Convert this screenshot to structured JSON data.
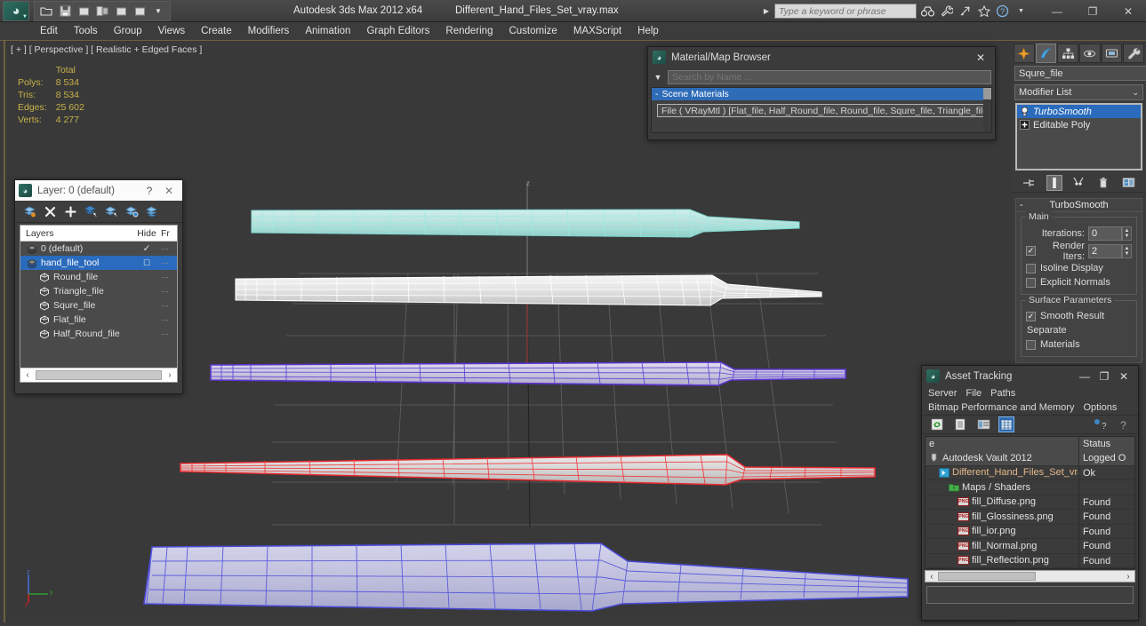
{
  "window": {
    "app_title": "Autodesk 3ds Max  2012 x64",
    "file_title": "Different_Hand_Files_Set_vray.max",
    "minimize": "—",
    "maximize": "❐",
    "close": "✕"
  },
  "quick_access": {
    "icons": [
      "open-file-icon",
      "save-file-icon",
      "undo-icon",
      "redo-icon",
      "blank-icon",
      "blank2-icon",
      "dropdown-arrow-icon"
    ]
  },
  "infocenter": {
    "placeholder": "Type a keyword or phrase",
    "value": "",
    "icons": [
      "binoculars-icon",
      "wrench-icon",
      "subscription-icon",
      "favorites-star-icon",
      "help-icon",
      "help-dropdown-icon"
    ]
  },
  "menu": {
    "items": [
      "Edit",
      "Tools",
      "Group",
      "Views",
      "Create",
      "Modifiers",
      "Animation",
      "Graph Editors",
      "Rendering",
      "Customize",
      "MAXScript",
      "Help"
    ]
  },
  "viewport": {
    "label": "[ + ] [ Perspective ] [ Realistic + Edged Faces ]",
    "stats": {
      "header": "Total",
      "rows": [
        {
          "label": "Polys:",
          "value": "8 534"
        },
        {
          "label": "Tris:",
          "value": "8 534"
        },
        {
          "label": "Edges:",
          "value": "25 602"
        },
        {
          "label": "Verts:",
          "value": "4 277"
        }
      ]
    },
    "axis_labels": {
      "z": "z",
      "y": "y",
      "x": "x"
    },
    "world_axis_labels": {
      "z": "z",
      "y": "y",
      "x": "x"
    },
    "object_colors": {
      "round_file": "#8fe3dc",
      "triangle_file": "#ffffff",
      "squre_file": "#6f4fd8",
      "flat_file": "#e8282d",
      "half_round_file": "#5b5bdd"
    }
  },
  "layer_window": {
    "title": "Layer: 0 (default)",
    "help_btn": "?",
    "close_btn": "✕",
    "toolbar_icons": [
      "create-new-layer-icon",
      "delete-layer-icon",
      "add-selection-icon",
      "select-objects-in-layer-icon",
      "select-highlighted-objects-icon",
      "highlight-selected-objects-icon",
      "hide-layer-icon"
    ],
    "columns": [
      "Layers",
      "Hide",
      "Fr"
    ],
    "rows": [
      {
        "name": "0 (default)",
        "glyph": "layer-icon",
        "indent": 0,
        "hide": "✓",
        "freeze": "····",
        "selected": false
      },
      {
        "name": "hand_file_tool",
        "glyph": "layer-icon",
        "indent": 0,
        "hide": "□",
        "freeze": "····",
        "selected": true
      },
      {
        "name": "Round_file",
        "glyph": "object-icon",
        "indent": 1,
        "hide": "",
        "freeze": "····",
        "selected": false
      },
      {
        "name": "Triangle_file",
        "glyph": "object-icon",
        "indent": 1,
        "hide": "",
        "freeze": "····",
        "selected": false
      },
      {
        "name": "Squre_file",
        "glyph": "object-icon",
        "indent": 1,
        "hide": "",
        "freeze": "····",
        "selected": false
      },
      {
        "name": "Flat_file",
        "glyph": "object-icon",
        "indent": 1,
        "hide": "",
        "freeze": "····",
        "selected": false
      },
      {
        "name": "Half_Round_file",
        "glyph": "object-icon",
        "indent": 1,
        "hide": "",
        "freeze": "····",
        "selected": false
      }
    ],
    "scroll_left": "‹",
    "scroll_right": "›"
  },
  "material_browser": {
    "title": "Material/Map Browser",
    "close_btn": "✕",
    "search_placeholder": "Search by Name ...",
    "search_value": "",
    "category": "Scene Materials",
    "entry": "File  ( VRayMtl )  [Flat_file, Half_Round_file, Round_file, Squre_file, Triangle_file]"
  },
  "command_panel": {
    "tabs": [
      "create-tab-icon",
      "modify-tab-icon",
      "hierarchy-tab-icon",
      "motion-tab-icon",
      "display-tab-icon",
      "utilities-tab-icon"
    ],
    "active_tab_index": 1,
    "object_name": "Squre_file",
    "object_color": "#74c02d",
    "modifier_list_label": "Modifier List",
    "chevron": "⌄",
    "stack": [
      {
        "label": "TurboSmooth",
        "selected": true,
        "glyph": "lightbulb-icon"
      },
      {
        "label": "Editable Poly",
        "selected": false,
        "glyph": "plus-box-icon"
      }
    ],
    "stack_buttons": [
      "pin-stack-icon",
      "show-end-result-icon",
      "make-unique-icon",
      "remove-modifier-icon",
      "configure-modifier-sets-icon"
    ],
    "rollout": {
      "title": "TurboSmooth",
      "collapse": "-",
      "groups": [
        {
          "title": "Main",
          "fields": [
            {
              "type": "spinner",
              "label": "Iterations:",
              "value": "0"
            },
            {
              "type": "check_spinner",
              "label": "Render Iters:",
              "value": "2",
              "checked": true
            },
            {
              "type": "checkbox",
              "label": "Isoline Display",
              "checked": false
            },
            {
              "type": "checkbox",
              "label": "Explicit Normals",
              "checked": false
            }
          ]
        },
        {
          "title": "Surface Parameters",
          "fields": [
            {
              "type": "checkbox",
              "label": "Smooth Result",
              "checked": true
            },
            {
              "type": "text",
              "label": "Separate"
            },
            {
              "type": "checkbox",
              "label": "Materials",
              "checked": false
            }
          ]
        }
      ]
    }
  },
  "asset_tracking": {
    "title": "Asset Tracking",
    "minimize": "—",
    "maximize": "❐",
    "close": "✕",
    "menus_row1": [
      "Server",
      "File",
      "Paths"
    ],
    "menus_row2": [
      "Bitmap Performance and Memory",
      "Options"
    ],
    "toolbar_icons": [
      "refresh-icon",
      "list-view-icon",
      "details-view-icon",
      "grid-view-icon",
      "help-new-icon",
      "help-icon"
    ],
    "columns": [
      "e",
      "Status"
    ],
    "rows": [
      {
        "name": "Autodesk Vault 2012",
        "status": "Logged O",
        "indent": 0,
        "glyph": "vault-icon",
        "kind": "vault"
      },
      {
        "name": "Different_Hand_Files_Set_vray.max",
        "status": "Ok",
        "indent": 1,
        "glyph": "max-file-icon",
        "kind": "maxfile"
      },
      {
        "name": "Maps / Shaders",
        "status": "",
        "indent": 2,
        "glyph": "maps-folder-icon",
        "kind": "group"
      },
      {
        "name": "fill_Diffuse.png",
        "status": "Found",
        "indent": 3,
        "glyph": "png-icon",
        "kind": "png"
      },
      {
        "name": "fill_Glossiness.png",
        "status": "Found",
        "indent": 3,
        "glyph": "png-icon",
        "kind": "png"
      },
      {
        "name": "fill_ior.png",
        "status": "Found",
        "indent": 3,
        "glyph": "png-icon",
        "kind": "png"
      },
      {
        "name": "fill_Normal.png",
        "status": "Found",
        "indent": 3,
        "glyph": "png-icon",
        "kind": "png"
      },
      {
        "name": "fill_Reflection.png",
        "status": "Found",
        "indent": 3,
        "glyph": "png-icon",
        "kind": "png"
      }
    ],
    "scroll_left": "‹",
    "scroll_right": "›",
    "status_text": ""
  }
}
